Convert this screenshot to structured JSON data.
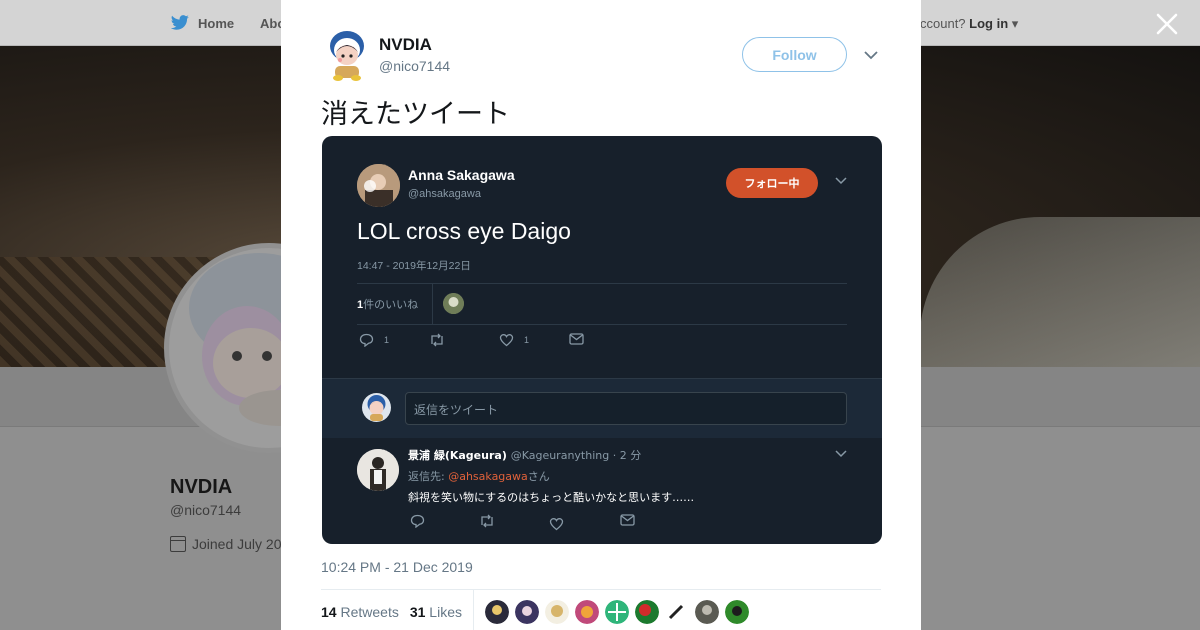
{
  "background": {
    "nav_home": "Home",
    "nav_about": "Abo",
    "login_prompt": "ccount?",
    "login_label": "Log in",
    "profile_name": "NVDIA",
    "profile_handle": "@nico7144",
    "joined": "Joined July 20"
  },
  "tweet": {
    "author_name": "NVDIA",
    "author_handle": "@nico7144",
    "follow_label": "Follow",
    "text": "消えたツイート",
    "date": "10:24 PM - 21 Dec 2019",
    "retweets_count": "14",
    "retweets_label": "Retweets",
    "likes_count": "31",
    "likes_label": "Likes"
  },
  "embedded": {
    "author_name": "Anna Sakagawa",
    "author_handle": "@ahsakagawa",
    "follow_state_label": "フォロー中",
    "text": "LOL cross eye Daigo",
    "timestamp": "14:47 - 2019年12月22日",
    "likes_count": "1",
    "likes_label": "件のいいね",
    "reply_count": "1",
    "like_count": "1",
    "reply_placeholder": "返信をツイート",
    "reply_author_name": "景浦 緑(Kageura)",
    "reply_author_meta": "@Kageuranything · 2 分",
    "reply_to_prefix": "返信先: ",
    "reply_to_mention": "@ahsakagawa",
    "reply_to_suffix": "さん",
    "reply_text": "斜視を笑い物にするのはちょっと酷いかなと思います……"
  },
  "colors": {
    "follow_outline": "#8fc2e8",
    "dark_bg": "#17202b",
    "orange_button": "#d2512a",
    "mention": "#e0613a"
  },
  "icons": [
    "twitter-bird-icon",
    "close-icon",
    "chevron-down-icon",
    "calendar-icon",
    "reply-icon",
    "retweet-icon",
    "heart-icon",
    "message-icon"
  ]
}
